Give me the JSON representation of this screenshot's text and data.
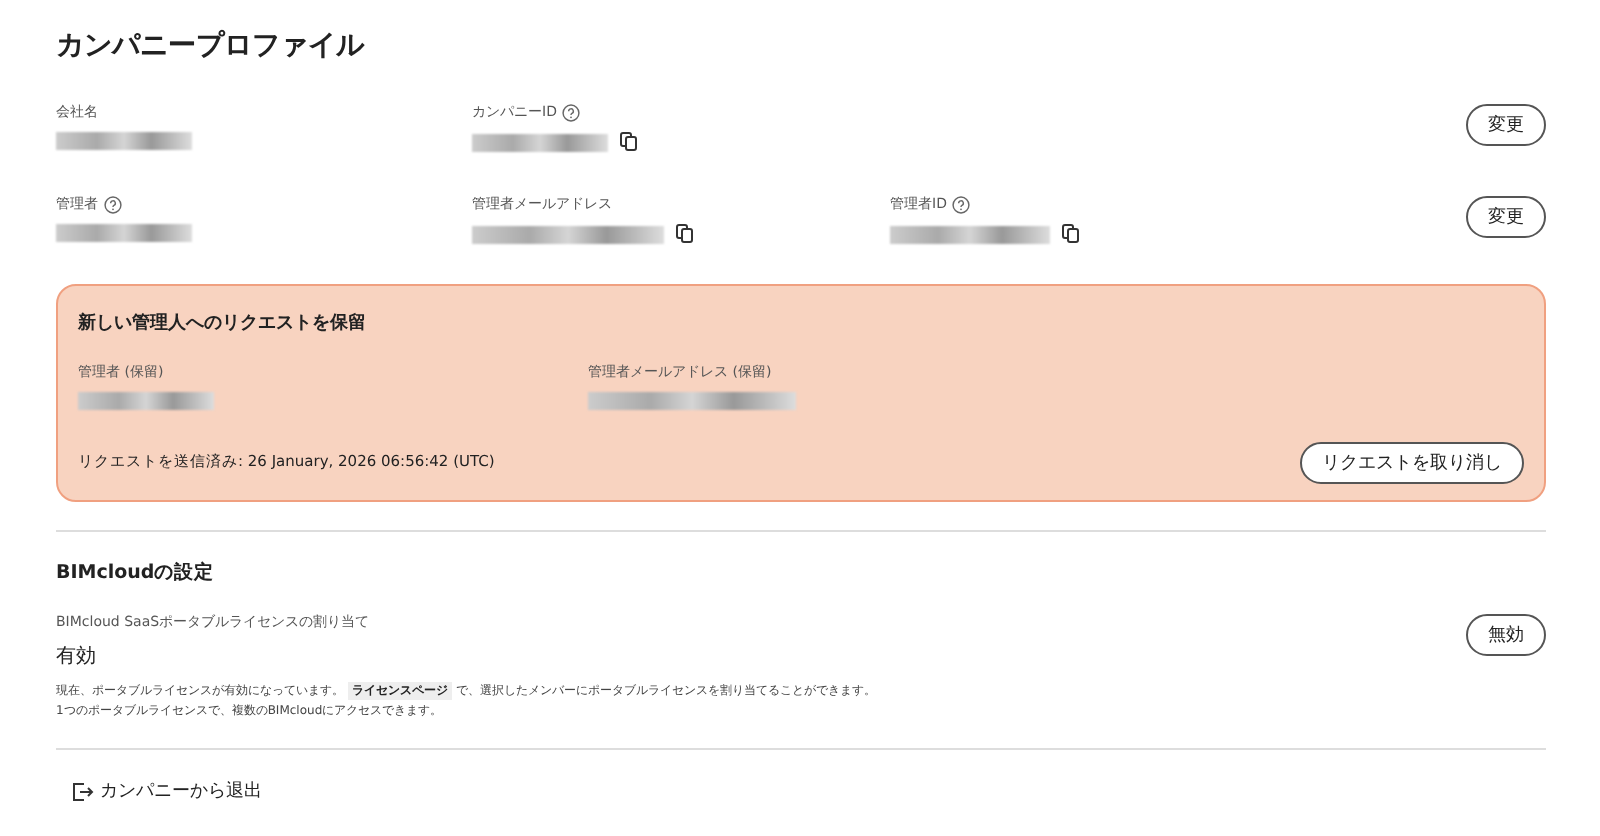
{
  "title": "カンパニープロファイル",
  "rows": [
    {
      "fields": [
        {
          "label": "会社名",
          "help": false,
          "copy": false,
          "redacted": true
        },
        {
          "label": "カンパニーID",
          "help": true,
          "copy": true,
          "redacted": true
        }
      ],
      "button": "変更"
    },
    {
      "fields": [
        {
          "label": "管理者",
          "help": true,
          "copy": false,
          "redacted": true
        },
        {
          "label": "管理者メールアドレス",
          "help": false,
          "copy": true,
          "redacted": true
        },
        {
          "label": "管理者ID",
          "help": true,
          "copy": true,
          "redacted": true
        }
      ],
      "button": "変更"
    }
  ],
  "pending": {
    "title": "新しい管理人へのリクエストを保留",
    "fields": [
      {
        "label": "管理者 (保留)",
        "redacted": true
      },
      {
        "label": "管理者メールアドレス (保留)",
        "redacted": true
      }
    ],
    "sent": "リクエストを送信済み: 26 January, 2026 06:56:42 (UTC)",
    "button": "リクエストを取り消し"
  },
  "bimcloud": {
    "title": "BIMcloudの設定",
    "label": "BIMcloud SaaSポータブルライセンスの割り当て",
    "value": "有効",
    "button": "無効",
    "note_before": "現在、ポータブルライセンスが有効になっています。",
    "note_link": "ライセンスページ",
    "note_after": "で、選択したメンバーにポータブルライセンスを割り当てることができます。",
    "note_line2": "1つのポータブルライセンスで、複数のBIMcloudにアクセスできます。"
  },
  "leave": "カンパニーから退出"
}
